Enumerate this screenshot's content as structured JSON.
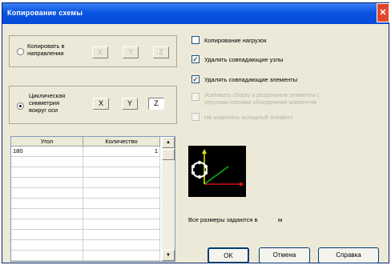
{
  "window": {
    "title": "Копирование схемы",
    "close_glyph": "✕"
  },
  "copy_direction": {
    "label_line1": "Копировать в",
    "label_line2": "направлении",
    "selected": false,
    "axes": [
      "X",
      "Y",
      "Z"
    ]
  },
  "cyclic_symmetry": {
    "label_line1": "Циклическая",
    "label_line2": "симметрия",
    "label_line3": "вокруг оси",
    "selected": true,
    "axes": [
      "X",
      "Y",
      "Z"
    ],
    "selected_axis": "Z"
  },
  "table": {
    "columns": [
      "Угол",
      "Количество"
    ],
    "rows": [
      {
        "angle": "180",
        "count": "1"
      }
    ],
    "scroll_up": "▲",
    "scroll_down": "▼"
  },
  "options": [
    {
      "label": "Копирование нагрузок",
      "checked": false,
      "enabled": true
    },
    {
      "label": "Удалять совпадающие узлы",
      "checked": true,
      "enabled": true
    },
    {
      "label": "Удалять совпадающие элементы",
      "checked": true,
      "enabled": true
    },
    {
      "label_line1": "Усиливать сборку в раздельные элементы с",
      "label_line2": "упругими связями объединения элементов",
      "checked": false,
      "enabled": false
    },
    {
      "label": "Не изменять исходный элемент",
      "checked": false,
      "enabled": false
    }
  ],
  "preview": {
    "icon": "axes-preview-icon",
    "axis_x_color": "#d01010",
    "axis_y_color": "#10b010",
    "axis_z_color": "#e8e800"
  },
  "units_note": {
    "text": "Все размеры задаются в",
    "unit": "м"
  },
  "buttons": {
    "ok": "OK",
    "cancel": "Отмена",
    "help": "Справка"
  }
}
